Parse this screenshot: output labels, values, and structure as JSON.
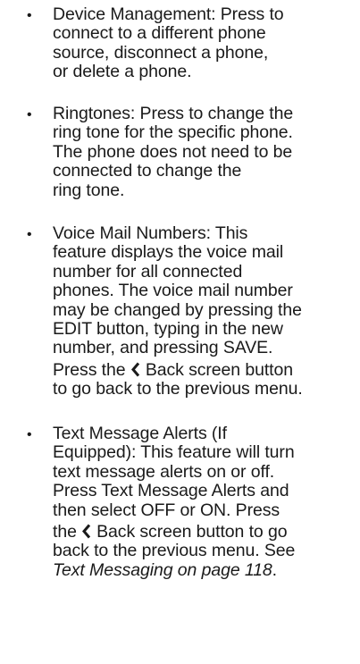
{
  "bullet_glyph": "•",
  "items": [
    {
      "lines": [
        "Device Management: Press to",
        "connect to a different phone",
        "source, disconnect a phone,",
        "or delete a phone."
      ]
    },
    {
      "lines": [
        "Ringtones: Press to change the",
        "ring tone for the specific phone.",
        "The phone does not need to be",
        "connected to change the",
        "ring tone."
      ]
    },
    {
      "lines": [
        "Voice Mail Numbers: This",
        "feature displays the voice mail",
        "number for all connected",
        "phones. The voice mail number",
        "may be changed by pressing the",
        "EDIT button, typing in the new",
        "number, and pressing SAVE."
      ],
      "line8_before": "Press the",
      "line8_after": "Back screen button",
      "line9": "to go back to the previous menu."
    },
    {
      "lines": [
        "Text Message Alerts (If",
        "Equipped): This feature will turn",
        "text message alerts on or off.",
        "Press Text Message Alerts and",
        "then select OFF or ON. Press"
      ],
      "line6_before": "the",
      "line6_after": "Back screen button to go",
      "line7_before": "back to the previous menu. See",
      "line8_italic": "Text Messaging on page 118",
      "line8_after": "."
    }
  ],
  "back_icon": "chevron-left-icon"
}
